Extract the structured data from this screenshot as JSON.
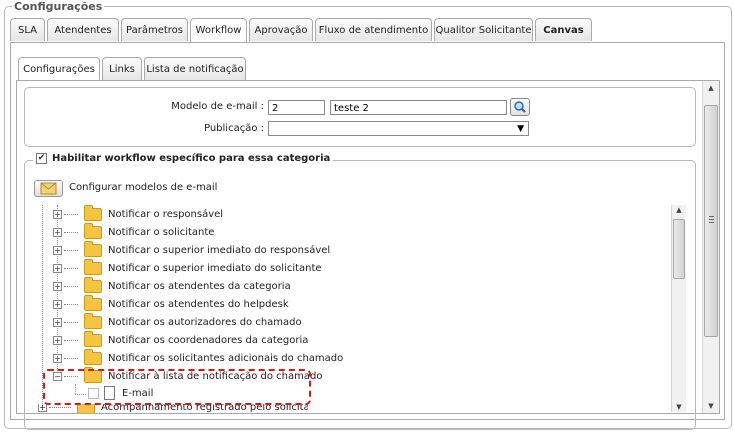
{
  "section_title": "Configurações",
  "tabs": [
    {
      "label": "SLA"
    },
    {
      "label": "Atendentes"
    },
    {
      "label": "Parâmetros"
    },
    {
      "label": "Workflow"
    },
    {
      "label": "Aprovação"
    },
    {
      "label": "Fluxo de atendimento"
    },
    {
      "label": "Qualitor Solicitante"
    },
    {
      "label": "Canvas"
    }
  ],
  "active_tab": "Workflow",
  "subtabs": [
    {
      "label": "Configurações"
    },
    {
      "label": "Links"
    },
    {
      "label": "Lista de notificação"
    }
  ],
  "form": {
    "modelo_label": "Modelo de e-mail :",
    "modelo_code": "2",
    "modelo_name": "teste 2",
    "publicacao_label": "Publicação :",
    "publicacao_value": "",
    "select_arrow": "▼"
  },
  "workflow_section": {
    "checkbox_checked": true,
    "checkbox_mark": "✔",
    "label": "Habilitar workflow específico para essa categoria",
    "config_button_label": "Configurar modelos de e-mail"
  },
  "tree": {
    "items": [
      "Notificar o responsável",
      "Notificar o solicitante",
      "Notificar o superior imediato do responsável",
      "Notificar o superior imediato do solicitante",
      "Notificar os atendentes da categoria",
      "Notificar os atendentes do helpdesk",
      "Notificar os autorizadores do chamado",
      "Notificar os coordenadores da categoria",
      "Notificar os solicitantes adicionais do chamado",
      "Notificar à lista de notificação do chamado"
    ],
    "expanded_child": "E-mail",
    "next_parent": "Acompanhamento registrado pelo solicitante",
    "expand_symbol": "+",
    "collapse_symbol": "−"
  },
  "scroll_up": "▲",
  "scroll_down": "▼",
  "colors": {
    "highlight_border": "#e01616",
    "folder": "#f4c542"
  }
}
